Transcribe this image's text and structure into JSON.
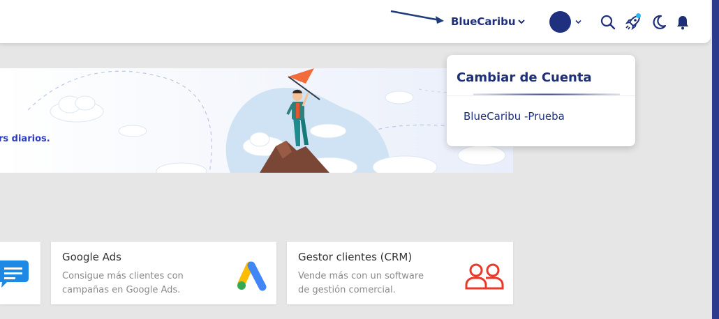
{
  "header": {
    "account_label": "BlueCaribu",
    "icons": [
      "arrow-annotation",
      "chevron-down-icon",
      "avatar",
      "search-icon",
      "rocket-icon",
      "moon-icon",
      "bell-icon"
    ]
  },
  "banner": {
    "text": "rs diarios."
  },
  "account_dropdown": {
    "title": "Cambiar de Cuenta",
    "items": [
      {
        "label": "BlueCaribu -Prueba"
      }
    ]
  },
  "cards": [
    {
      "title": "Google Ads",
      "description": "Consigue más clientes con campañas en Google Ads.",
      "icon": "google-ads-icon"
    },
    {
      "title": "Gestor clientes (CRM)",
      "description": "Vende más con un software de gestión comercial.",
      "icon": "users-icon"
    }
  ],
  "colors": {
    "brand": "#1e2f7a",
    "background": "#e6e6e6",
    "notification_dot": "#29b6f6",
    "crm_icon": "#e8392b"
  }
}
